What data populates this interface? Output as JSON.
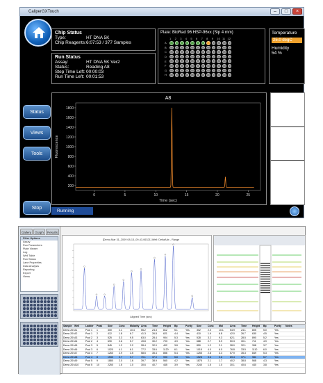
{
  "top_window": {
    "title": "CaliperGXTouch",
    "chip_status": {
      "title": "Chip Status",
      "type_label": "Type:",
      "type_value": "HT DNA 5K",
      "reagents_label": "Chip Reagents:",
      "reagents_value": "6:07:53 / 377 Samples"
    },
    "run_status": {
      "title": "Run Status",
      "assay_label": "Assay:",
      "assay_value": "HT DNA 5K Ver2",
      "status_label": "Status:",
      "status_value": "Reading A8",
      "step_label": "Step Time Left:",
      "step_value": "00:00:03",
      "run_label": "Run Time Left:",
      "run_value": "00:01:53"
    },
    "plate": {
      "title": "Plate:  BioRad 96 HSP-96xx  (Sip 4 mm)",
      "rows": [
        "A",
        "B",
        "C",
        "D",
        "E",
        "F",
        "G",
        "H"
      ],
      "cols": [
        "1",
        "2",
        "3",
        "4",
        "5",
        "6",
        "7",
        "8",
        "9",
        "10",
        "11",
        "12"
      ],
      "done_count": 7,
      "current": "A8"
    },
    "temperature": {
      "label": "Temperature",
      "value": "25.0 degC",
      "humidity_label": "Humidity",
      "humidity_value": "54 %"
    },
    "side_buttons": [
      "Status",
      "Views",
      "Tools",
      "Stop"
    ],
    "status_bar": "Running",
    "colors": {
      "accent": "#f0a22e",
      "button": "#1d4e8c"
    }
  },
  "chart_data": [
    {
      "type": "line",
      "title": "A8",
      "xlabel": "Time (sec)",
      "ylabel": "Fluorescence",
      "xlim": [
        -3,
        27
      ],
      "ylim": [
        100,
        1900
      ],
      "xticks": [
        "0",
        "5",
        "10",
        "15",
        "20",
        "25"
      ],
      "yticks": [
        "200",
        "400",
        "600",
        "800",
        "1000",
        "1200",
        "1400",
        "1600",
        "1800"
      ],
      "series": [
        {
          "color": "#e8862a",
          "baseline": 165,
          "peaks": [
            {
              "x": 12.6,
              "y": 1800
            },
            {
              "x": 21.3,
              "y": 380
            }
          ]
        }
      ]
    },
    {
      "type": "line",
      "title": "[Demo.Mar 31_2009 08-13_09-43-06321] Well: DeltaAdx - Range",
      "xlabel": "Aligned Time (sec)",
      "series": [
        {
          "color": "#4a5fc9",
          "peaks": [
            {
              "x": 0.08,
              "y": 0.62
            },
            {
              "x": 0.17,
              "y": 0.2
            },
            {
              "x": 0.23,
              "y": 0.2
            },
            {
              "x": 0.3,
              "y": 0.35
            },
            {
              "x": 0.37,
              "y": 0.42
            },
            {
              "x": 0.43,
              "y": 0.55
            },
            {
              "x": 0.5,
              "y": 0.58
            },
            {
              "x": 0.6,
              "y": 0.75
            },
            {
              "x": 0.68,
              "y": 0.8
            },
            {
              "x": 0.74,
              "y": 0.95
            },
            {
              "x": 0.88,
              "y": 0.18
            }
          ]
        }
      ]
    }
  ],
  "bottom_window": {
    "tabs": [
      "Gallery",
      "Graph",
      "Results"
    ],
    "nav_title": "Filter Options",
    "nav_items": [
      "Assay",
      "Run Parameters",
      "Plate Viewer",
      "Log",
      "Well Table",
      "Run Status",
      "Lane Properties",
      "Data Analysis",
      "Reporting",
      "Export",
      "Views"
    ],
    "grid_header": [
      "Sample",
      "Well",
      "Ladder",
      "Peak",
      "Size",
      "Conc",
      "Molarity",
      "Area",
      "Time",
      "Height",
      "Bp",
      "Purity",
      "Size",
      "Conc",
      "Mol",
      "Area",
      "Time",
      "Height",
      "Bp",
      "Purity",
      "Notes"
    ],
    "grid_rows": [
      [
        "Demo 2009",
        "A1",
        "Pool 1",
        "1",
        "300",
        "2.1",
        "10.4",
        "55.2",
        "24.3",
        "812",
        "5.1",
        "Yes",
        "302",
        "2.0",
        "10.1",
        "54.9",
        "24.1",
        "805",
        "5.0",
        "Yes",
        ""
      ],
      [
        "Demo 2009",
        "A2",
        "Pool 1",
        "2",
        "412",
        "1.8",
        "6.7",
        "41.3",
        "26.8",
        "621",
        "4.4",
        "Yes",
        "410",
        "1.9",
        "6.8",
        "42.0",
        "26.7",
        "630",
        "4.5",
        "Yes",
        ""
      ],
      [
        "Demo 2009",
        "A3",
        "Pool 2",
        "3",
        "525",
        "3.3",
        "9.5",
        "63.0",
        "28.4",
        "904",
        "5.3",
        "Yes",
        "528",
        "3.2",
        "9.3",
        "62.1",
        "28.5",
        "890",
        "5.2",
        "Yes",
        ""
      ],
      [
        "Demo 2009",
        "A4",
        "Pool 2",
        "4",
        "690",
        "2.6",
        "5.7",
        "49.8",
        "30.2",
        "703",
        "4.9",
        "Yes",
        "688",
        "2.7",
        "5.9",
        "50.3",
        "30.1",
        "711",
        "4.9",
        "Yes",
        ""
      ],
      [
        "Demo 2009",
        "A5",
        "Pool 3",
        "5",
        "845",
        "1.2",
        "2.2",
        "28.4",
        "32.0",
        "402",
        "3.8",
        "Yes",
        "850",
        "1.2",
        "2.1",
        "28.0",
        "32.1",
        "398",
        "3.7",
        "Yes",
        ""
      ],
      [
        "Demo 2009",
        "A6",
        "Pool 3",
        "6",
        "1020",
        "4.1",
        "6.1",
        "77.2",
        "33.6",
        "1120",
        "6.1",
        "Yes",
        "1015",
        "4.0",
        "6.0",
        "76.8",
        "33.5",
        "1110",
        "6.0",
        "Yes",
        ""
      ],
      [
        "Demo 2009",
        "A7",
        "Pool 4",
        "7",
        "1260",
        "2.9",
        "3.5",
        "58.5",
        "35.4",
        "856",
        "5.4",
        "Yes",
        "1255",
        "2.8",
        "3.4",
        "57.9",
        "35.3",
        "849",
        "5.3",
        "Yes",
        ""
      ],
      [
        "Demo 2009",
        "A8",
        "Pool 4",
        "8",
        "1530",
        "3.7",
        "3.7",
        "70.1",
        "37.0",
        "990",
        "5.8",
        "Yes",
        "1528",
        "3.6",
        "3.6",
        "69.4",
        "37.1",
        "981",
        "5.7",
        "Yes",
        ""
      ],
      [
        "Demo 2009",
        "A9",
        "Pool 5",
        "9",
        "1880",
        "2.0",
        "1.6",
        "39.7",
        "38.9",
        "560",
        "4.2",
        "Yes",
        "1875",
        "2.1",
        "1.7",
        "40.2",
        "38.8",
        "568",
        "4.3",
        "Yes",
        ""
      ],
      [
        "Demo 2009",
        "A10",
        "Pool 5",
        "10",
        "2250",
        "1.5",
        "1.0",
        "30.6",
        "40.7",
        "445",
        "3.9",
        "Yes",
        "2240",
        "1.5",
        "1.0",
        "30.1",
        "40.6",
        "440",
        "3.8",
        "Yes",
        ""
      ]
    ],
    "selected_row": 7
  }
}
